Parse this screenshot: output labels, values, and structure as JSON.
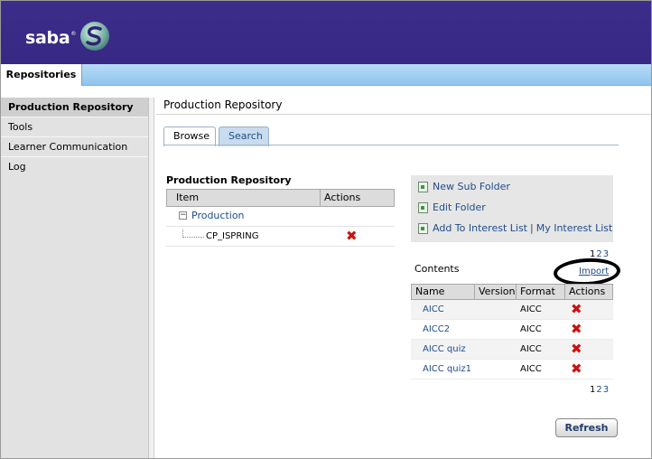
{
  "brand": {
    "logo_text": "saba",
    "reg": "®"
  },
  "top_tabs": [
    {
      "label": "Repositories"
    }
  ],
  "sidebar": {
    "items": [
      {
        "label": "Production Repository",
        "active": true
      },
      {
        "label": "Tools",
        "active": false
      },
      {
        "label": "Learner Communication Log",
        "active": false
      }
    ]
  },
  "page_title": "Production Repository",
  "tabs": {
    "browse": "Browse",
    "search": "Search"
  },
  "tree": {
    "title": "Production Repository",
    "col_item": "Item",
    "col_actions": "Actions",
    "minus": "−",
    "root": "Production",
    "child": "CP_ISPRING",
    "delete_glyph": "✖"
  },
  "actions": {
    "new_sub_folder": "New Sub Folder",
    "edit_folder": "Edit Folder",
    "add_to_interest_list": "Add To Interest List",
    "separator": "|",
    "my_interest_list": "My Interest List"
  },
  "pager": {
    "p1": "1",
    "p2": "2",
    "p3": "3"
  },
  "contents": {
    "label": "Contents",
    "import": "Import",
    "columns": {
      "name": "Name",
      "version": "Version",
      "format": "Format",
      "actions": "Actions"
    },
    "rows": [
      {
        "name": "AICC",
        "version": "",
        "format": "AICC",
        "action": "✖"
      },
      {
        "name": "AICC2",
        "version": "",
        "format": "AICC",
        "action": "✖"
      },
      {
        "name": "AICC quiz",
        "version": "",
        "format": "AICC",
        "action": "✖"
      },
      {
        "name": "AICC quiz1",
        "version": "",
        "format": "AICC",
        "action": "✖"
      }
    ]
  },
  "refresh_label": "Refresh",
  "colors": {
    "header": "#3a2b88",
    "tabbar": "#8ec5ee",
    "link": "#1f4c8a",
    "delete": "#cc1111"
  }
}
